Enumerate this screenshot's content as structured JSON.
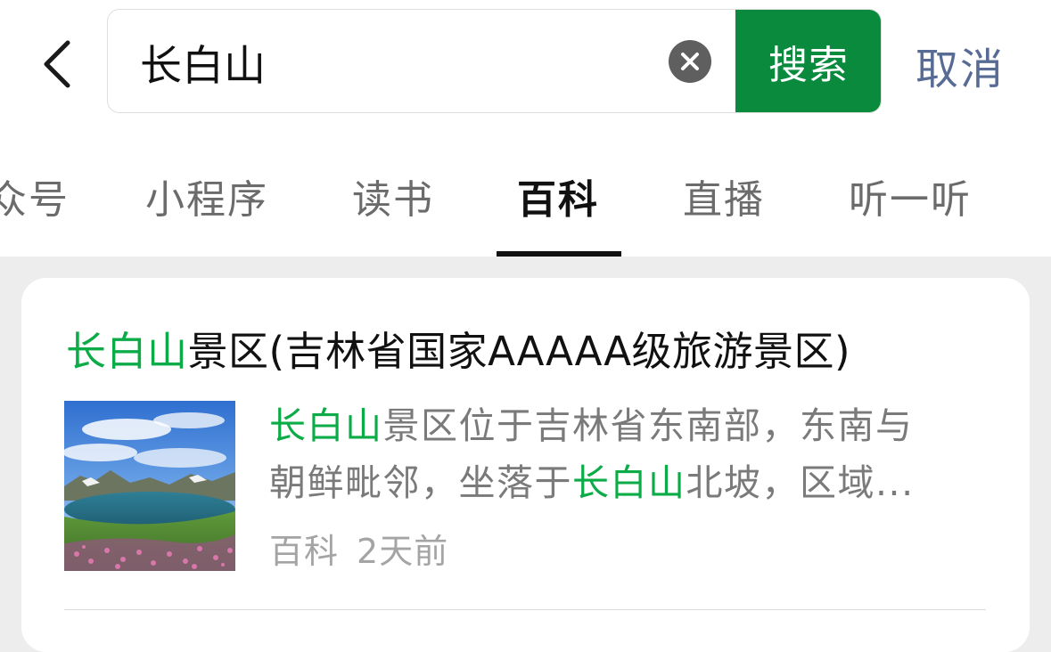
{
  "search": {
    "query": "长白山",
    "button_label": "搜索",
    "cancel_label": "取消"
  },
  "tabs": [
    {
      "label": "众号",
      "active": false
    },
    {
      "label": "小程序",
      "active": false
    },
    {
      "label": "读书",
      "active": false
    },
    {
      "label": "百科",
      "active": true
    },
    {
      "label": "直播",
      "active": false
    },
    {
      "label": "听一听",
      "active": false
    }
  ],
  "result": {
    "title_highlight": "长白山",
    "title_rest": "景区(吉林省国家AAAAA级旅游景区)",
    "desc_line1_hl": "长白山",
    "desc_line1_rest": "景区位于吉林省东南部，东南与",
    "desc_line2_pre": "朝鲜毗邻，坐落于",
    "desc_line2_hl": "长白山",
    "desc_line2_post": "北坡，区域...",
    "source": "百科",
    "time": "2天前"
  },
  "colors": {
    "accent_green": "#0a8a3d",
    "highlight_green": "#0bab47",
    "cancel_blue": "#576b95"
  },
  "icons": {
    "back": "chevron-left-icon",
    "clear": "close-circle-icon"
  }
}
